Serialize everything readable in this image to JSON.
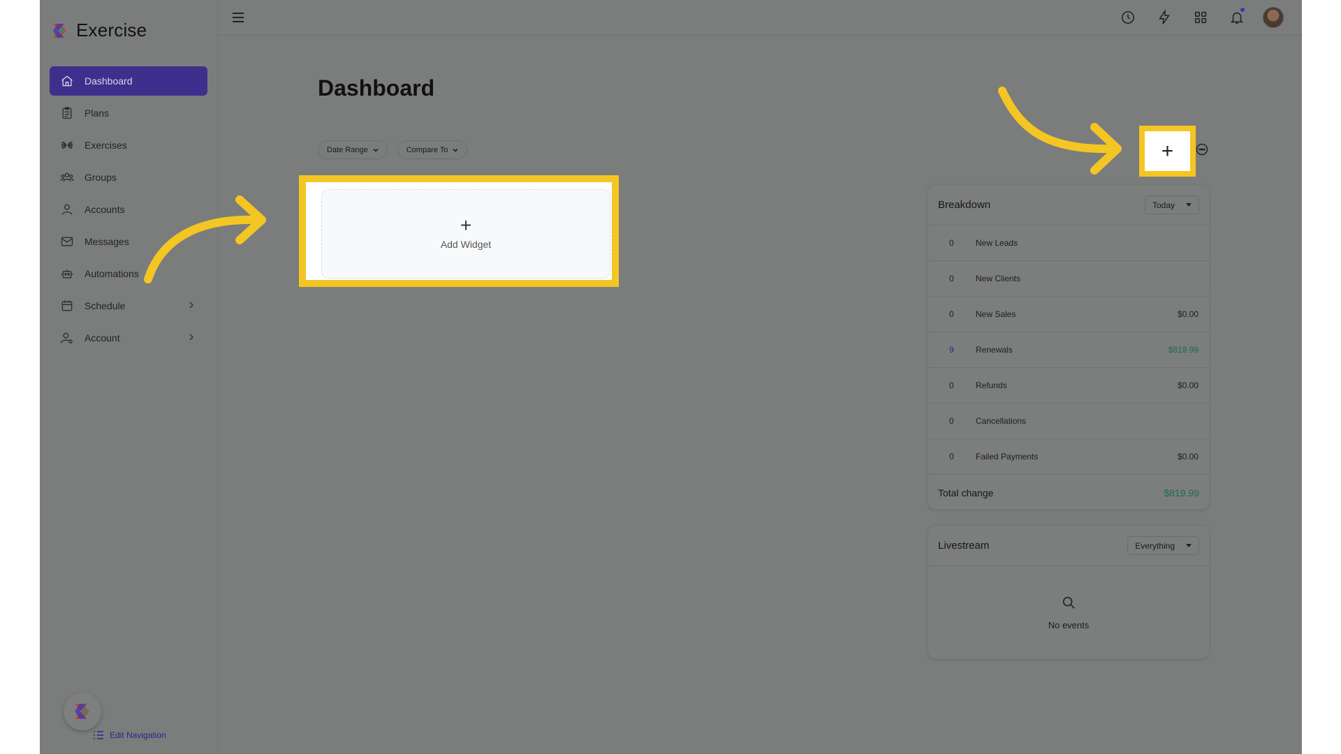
{
  "app": {
    "name": "Exercise"
  },
  "sidebar": {
    "items": [
      {
        "label": "Dashboard",
        "icon": "home-icon"
      },
      {
        "label": "Plans",
        "icon": "clipboard-icon"
      },
      {
        "label": "Exercises",
        "icon": "dumbbell-icon"
      },
      {
        "label": "Groups",
        "icon": "users-icon"
      },
      {
        "label": "Accounts",
        "icon": "user-icon"
      },
      {
        "label": "Messages",
        "icon": "mail-icon"
      },
      {
        "label": "Automations",
        "icon": "robot-icon"
      },
      {
        "label": "Schedule",
        "icon": "calendar-icon"
      },
      {
        "label": "Account",
        "icon": "user-gear-icon"
      }
    ],
    "edit_navigation": "Edit Navigation"
  },
  "main": {
    "title": "Dashboard",
    "filters": {
      "date_range": "Date Range",
      "compare_to": "Compare To"
    },
    "add_widget": {
      "plus": "+",
      "label": "Add Widget"
    },
    "add_button": "+"
  },
  "breakdown": {
    "title": "Breakdown",
    "period": "Today",
    "rows": [
      {
        "count": "0",
        "label": "New Leads",
        "amount": ""
      },
      {
        "count": "0",
        "label": "New Clients",
        "amount": ""
      },
      {
        "count": "0",
        "label": "New Sales",
        "amount": "$0.00"
      },
      {
        "count": "9",
        "label": "Renewals",
        "amount": "$819.99"
      },
      {
        "count": "0",
        "label": "Refunds",
        "amount": "$0.00"
      },
      {
        "count": "0",
        "label": "Cancellations",
        "amount": ""
      },
      {
        "count": "0",
        "label": "Failed Payments",
        "amount": "$0.00"
      }
    ],
    "total_label": "Total change",
    "total_amount": "$819.99"
  },
  "livestream": {
    "title": "Livestream",
    "filter": "Everything",
    "empty_text": "No events"
  },
  "colors": {
    "highlight": "#f4c623",
    "accent": "#3e2f8c",
    "positive": "#1d6b4c"
  }
}
